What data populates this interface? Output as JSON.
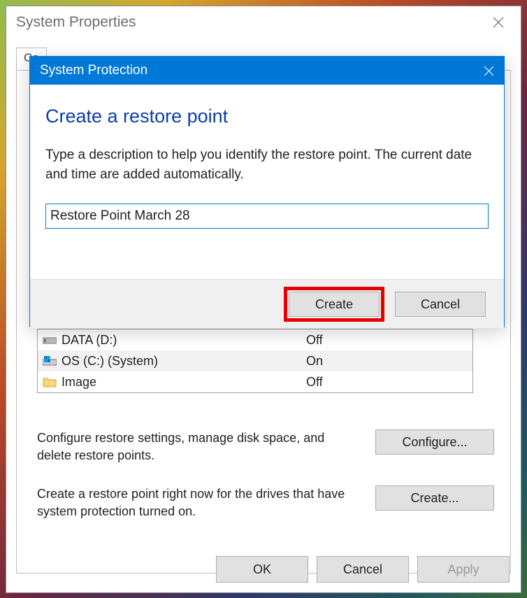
{
  "sysprop": {
    "title": "System Properties",
    "tab_visible": "Co",
    "buttons": {
      "ok": "OK",
      "cancel": "Cancel",
      "apply": "Apply"
    }
  },
  "drives": [
    {
      "icon": "hdd-icon",
      "name": "DATA (D:)",
      "protection": "Off"
    },
    {
      "icon": "osdisk-icon",
      "name": "OS (C:) (System)",
      "protection": "On"
    },
    {
      "icon": "folder-icon",
      "name": "Image",
      "protection": "Off"
    }
  ],
  "settings": {
    "configure_text": "Configure restore settings, manage disk space, and delete restore points.",
    "configure_btn": "Configure...",
    "create_text": "Create a restore point right now for the drives that have system protection turned on.",
    "create_btn": "Create..."
  },
  "sysprot": {
    "title": "System Protection",
    "heading": "Create a restore point",
    "description": "Type a description to help you identify the restore point. The current date and time are added automatically.",
    "input_value": "Restore Point March 28",
    "create_btn": "Create",
    "cancel_btn": "Cancel"
  }
}
